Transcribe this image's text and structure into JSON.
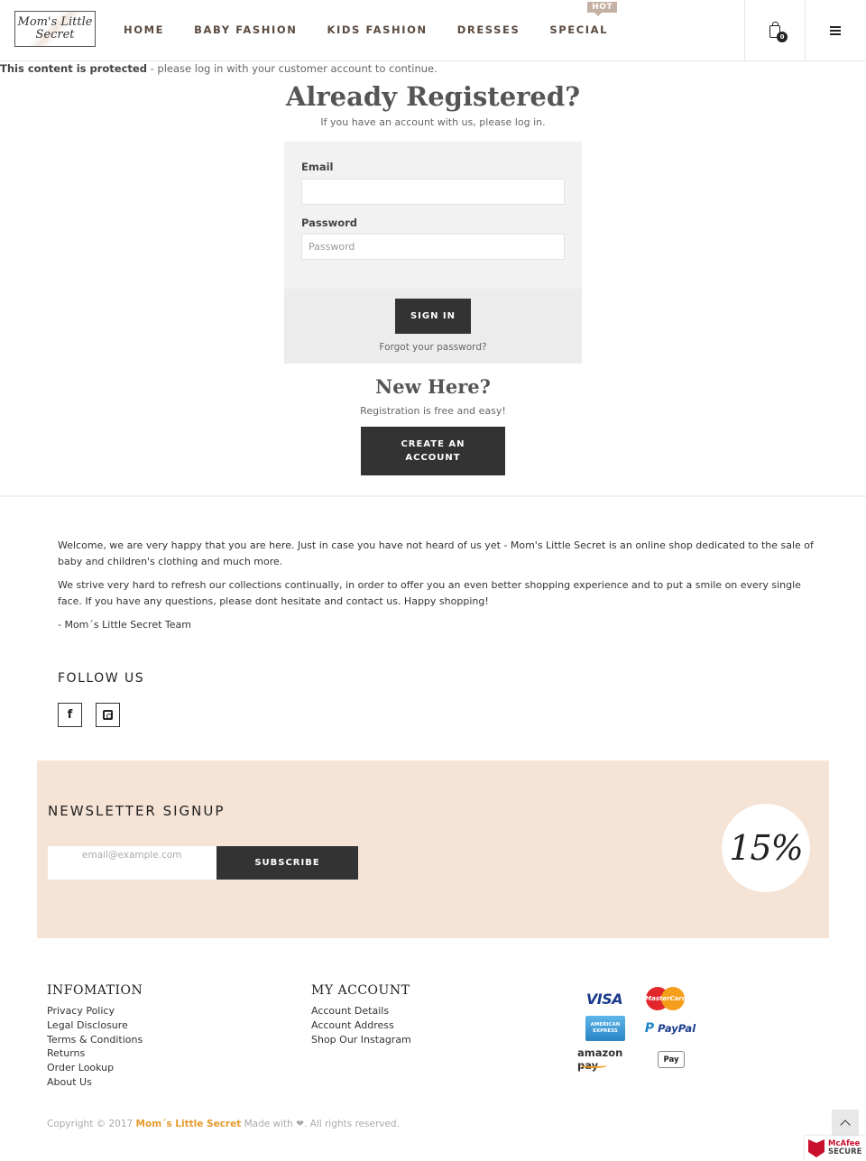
{
  "header": {
    "logo_line1": "Mom's Little",
    "logo_line2": "Secret",
    "nav": [
      {
        "label": "HOME"
      },
      {
        "label": "BABY FASHION"
      },
      {
        "label": "KIDS FASHION"
      },
      {
        "label": "DRESSES"
      },
      {
        "label": "SPECIAL",
        "badge": "Hot"
      }
    ],
    "cart_count": "0",
    "cart_icon": "shopping-bag-icon",
    "menu_icon": "hamburger-menu-icon"
  },
  "notice": {
    "bold": "This content is protected",
    "rest": " - please log in with your customer account to continue."
  },
  "login": {
    "title": "Already Registered?",
    "subtitle": "If you have an account with us, please log in.",
    "email_label": "Email",
    "email_value": "",
    "password_label": "Password",
    "password_placeholder": "Password",
    "signin_label": "SIGN IN",
    "forgot_label": "Forgot your password?"
  },
  "register": {
    "title": "New Here?",
    "subtitle": "Registration is free and easy!",
    "button_label": "CREATE AN ACCOUNT"
  },
  "about": {
    "paragraphs": [
      "Welcome, we are very happy that you are here. Just in case you have not heard of us yet - Mom's Little Secret is an online shop dedicated to the sale of baby and children's clothing and much more.",
      "We strive very hard to refresh our collections continually, in order to offer you an even better shopping experience and to put a smile on every single face. If you have any questions, please dont hesitate and contact us. Happy shopping!",
      "- Mom´s Little Secret Team"
    ]
  },
  "follow": {
    "title": "FOLLOW US",
    "icons": [
      "facebook-icon",
      "instagram-icon"
    ],
    "facebook_glyph": "f"
  },
  "newsletter": {
    "title": "NEWSLETTER SIGNUP",
    "placeholder": "email@example.com",
    "button_label": "SUBSCRIBE",
    "promo": "15%",
    "bg_color": "#f5e3d6"
  },
  "footer": {
    "col1_title": "INFOMATION",
    "col1_links": [
      "Privacy Policy",
      "Legal Disclosure",
      "Terms & Conditions",
      "Returns",
      "Order Lookup",
      "About Us"
    ],
    "col2_title": "MY ACCOUNT",
    "col2_links": [
      "Account Details",
      "Account Address",
      "Shop Our Instagram"
    ],
    "payments": {
      "visa": "VISA",
      "mastercard": "MasterCard",
      "amex_line1": "AMERICAN",
      "amex_line2": "EXPRESS",
      "paypal_p": "P",
      "paypal": "PayPal",
      "amazon": "amazon pay",
      "apple": " Pay"
    },
    "copyright_pre": "Copyright © 2017 ",
    "copyright_brand": "Mom´s Little Secret",
    "copyright_post": " Made with ❤. All rights reserved.",
    "brand_color": "#e59a2d",
    "mcafee_line1": "McAfee",
    "mcafee_line2": "SECURE"
  }
}
